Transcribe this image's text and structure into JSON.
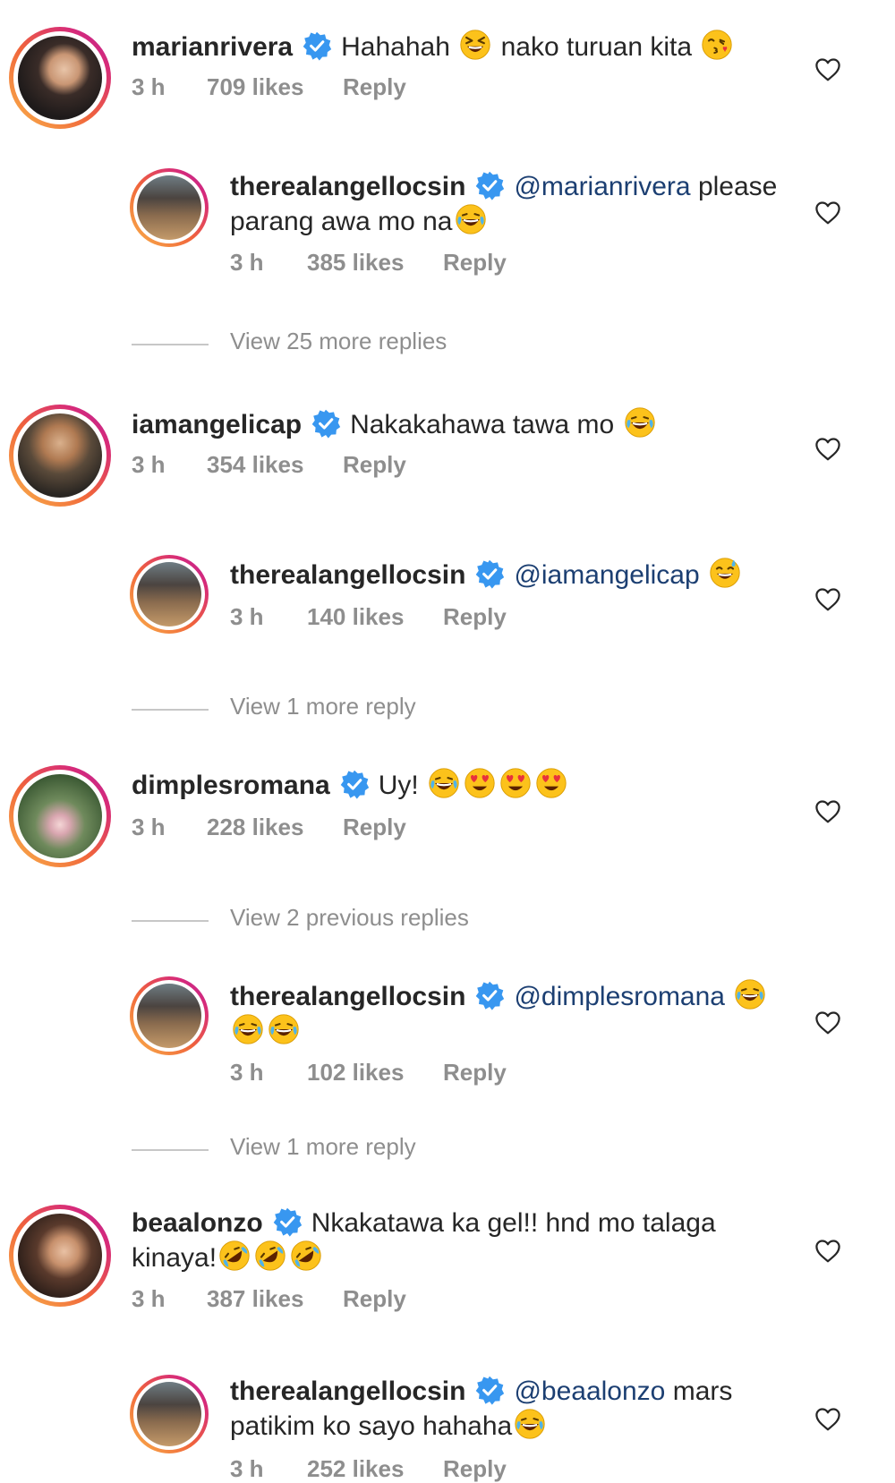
{
  "comments": [
    {
      "username": "marianrivera",
      "text_before": "Hahahah",
      "text_mid": "nako turuan kita",
      "time": "3 h",
      "likes": "709 likes",
      "reply": "Reply"
    },
    {
      "username": "therealangellocsin",
      "mention": "@marianrivera",
      "text_line1": "please",
      "text_line2": "parang awa mo na",
      "time": "3 h",
      "likes": "385 likes",
      "reply": "Reply"
    },
    {
      "username": "iamangelicap",
      "text": "Nakakahawa tawa mo",
      "time": "3 h",
      "likes": "354 likes",
      "reply": "Reply"
    },
    {
      "username": "therealangellocsin",
      "mention": "@iamangelicap",
      "time": "3 h",
      "likes": "140 likes",
      "reply": "Reply"
    },
    {
      "username": "dimplesromana",
      "text": "Uy!",
      "time": "3 h",
      "likes": "228 likes",
      "reply": "Reply"
    },
    {
      "username": "therealangellocsin",
      "mention": "@dimplesromana",
      "time": "3 h",
      "likes": "102 likes",
      "reply": "Reply"
    },
    {
      "username": "beaalonzo",
      "text_line1": "Nkakatawa ka gel!! hnd mo talaga",
      "text_line2": "kinaya!",
      "time": "3 h",
      "likes": "387 likes",
      "reply": "Reply"
    },
    {
      "username": "therealangellocsin",
      "mention": "@beaalonzo",
      "text_line1": "mars",
      "text_line2": "patikim ko sayo hahaha",
      "time": "3 h",
      "likes": "252 likes",
      "reply": "Reply"
    }
  ],
  "view_more": [
    "View 25 more replies",
    "View 1 more reply",
    "View 2 previous replies",
    "View 1 more reply"
  ],
  "icons": {
    "verified": "verified-badge-icon",
    "like": "heart-outline-icon"
  },
  "colors": {
    "verified": "#3897f0",
    "mention": "#1c3f72",
    "meta": "#8e8e8e"
  }
}
